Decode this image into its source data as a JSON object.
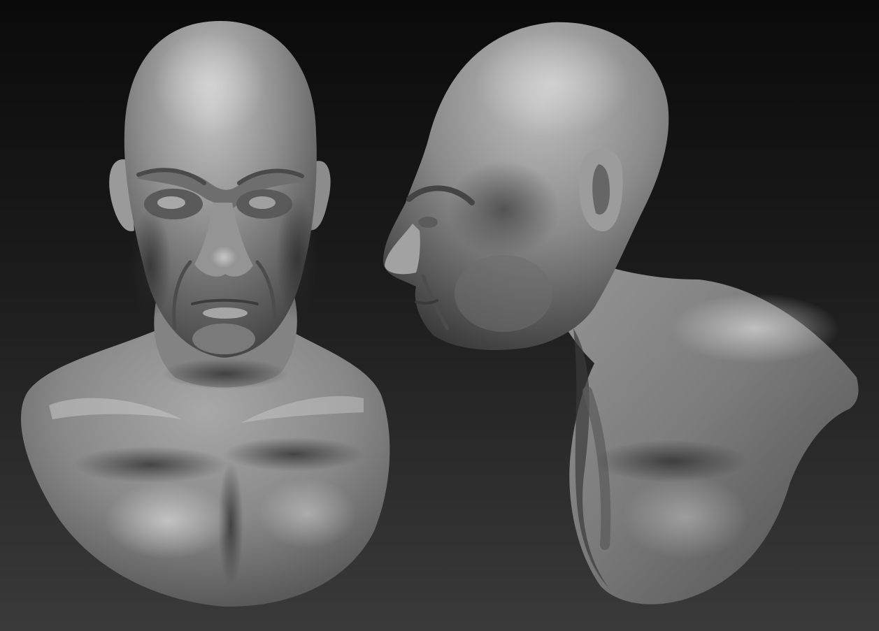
{
  "scene": {
    "colors": {
      "background_top": "#0a0a0a",
      "background_bottom": "#3a3a3a",
      "clay_light": "#b8b8b8",
      "clay_mid": "#8a8a8a",
      "clay_dark": "#3c3c3c"
    },
    "views": [
      {
        "name": "front-view",
        "material": "grey-clay"
      },
      {
        "name": "side-view",
        "material": "grey-clay"
      }
    ]
  }
}
